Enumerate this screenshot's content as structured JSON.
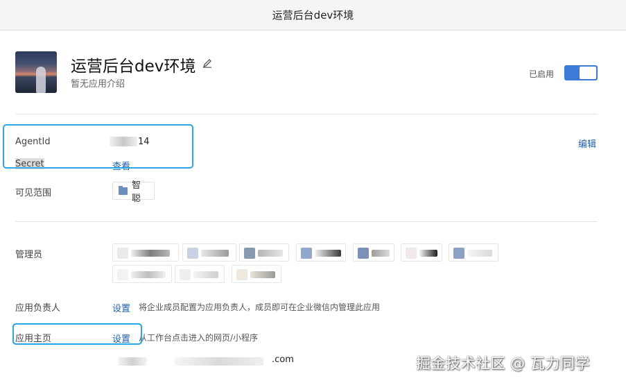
{
  "window": {
    "title": "运营后台dev环境"
  },
  "app": {
    "name": "运营后台dev环境",
    "description": "暂无应用介绍",
    "status_label": "已启用",
    "enabled": true
  },
  "credentials": {
    "agentid_label": "AgentId",
    "agentid_value_visible": "14",
    "secret_label": "Secret",
    "secret_action": "查看",
    "edit_label": "编辑"
  },
  "scope": {
    "label": "可见范围",
    "tags": [
      "智聪"
    ]
  },
  "admins": {
    "label": "管理员",
    "count": 10
  },
  "owner": {
    "label": "应用负责人",
    "action": "设置",
    "hint": "将企业成员配置为应用负责人，成员即可在企业微信内管理此应用"
  },
  "homepage": {
    "label": "应用主页",
    "action": "设置",
    "hint": "从工作台点击进入的网页/小程序",
    "url_suffix": ".com"
  },
  "watermark": "掘金技术社区 @ 瓦力同学",
  "colors": {
    "accent": "#3b7ad6",
    "link": "#1f5fa8",
    "highlight": "#2ba6e6"
  }
}
